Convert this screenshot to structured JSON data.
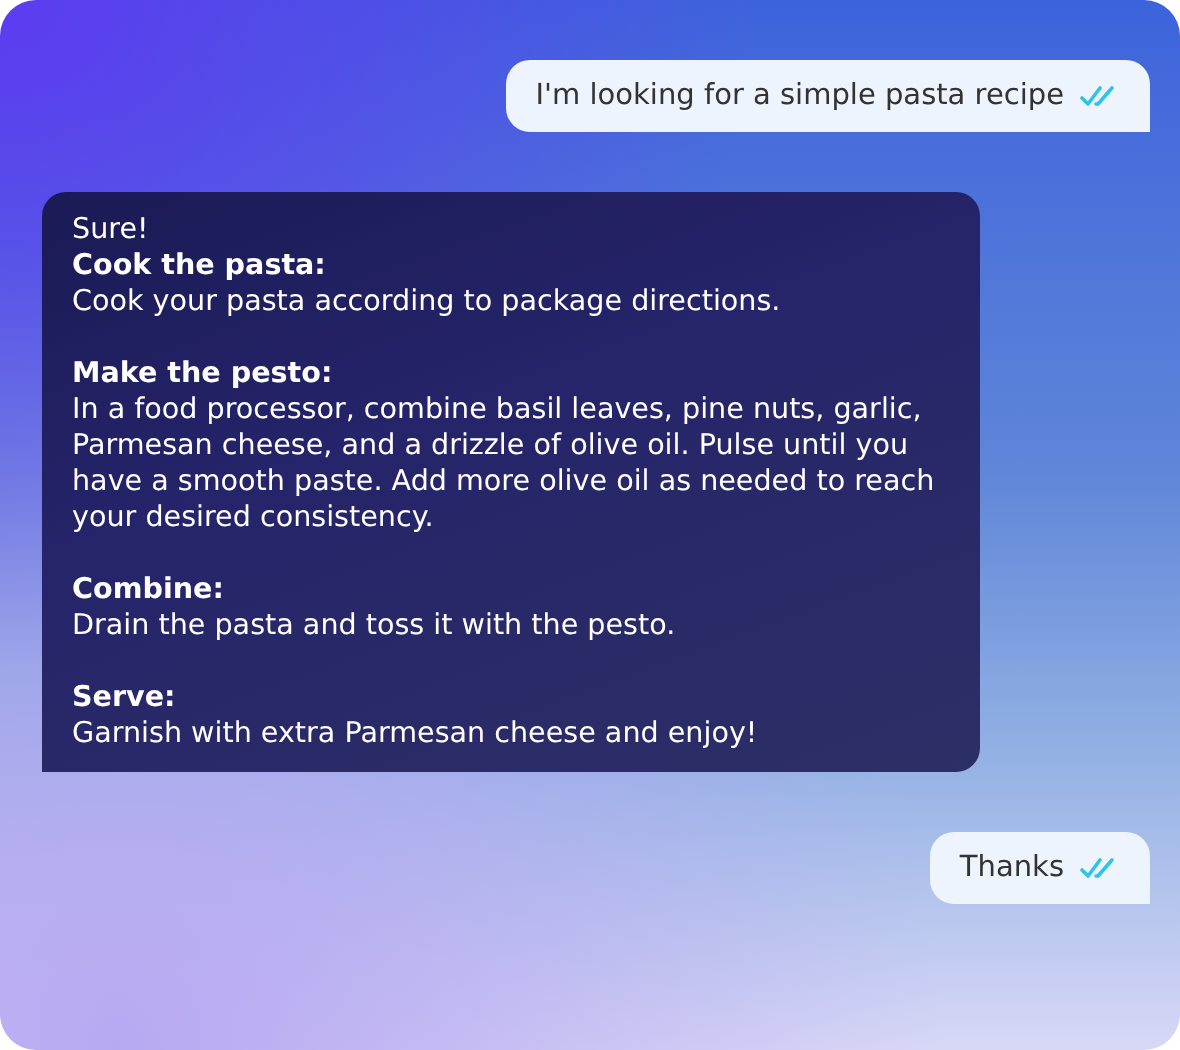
{
  "messages": [
    {
      "kind": "user",
      "text": "I'm looking for a simple pasta recipe"
    },
    {
      "kind": "assistant",
      "intro": "Sure!",
      "sections": [
        {
          "heading": "Cook the pasta:",
          "body": "Cook your pasta according to package directions."
        },
        {
          "heading": "Make the pesto:",
          "body": "In a food processor, combine basil leaves, pine nuts, garlic, Parmesan cheese, and a drizzle of olive oil. Pulse until you have a smooth paste. Add more olive oil as needed to reach your desired consistency."
        },
        {
          "heading": "Combine:",
          "body": "Drain the pasta and toss it with the pesto."
        },
        {
          "heading": "Serve:",
          "body": "Garnish with extra Parmesan cheese and enjoy!"
        }
      ]
    },
    {
      "kind": "user",
      "text": "Thanks"
    }
  ]
}
